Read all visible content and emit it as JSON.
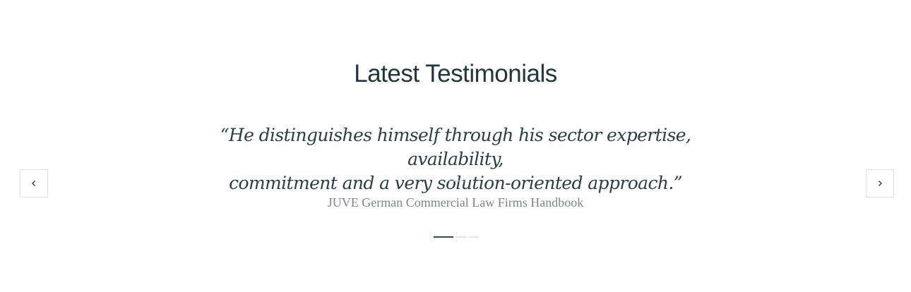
{
  "section": {
    "title": "Latest Testimonials"
  },
  "testimonial": {
    "quote_line1": "“He distinguishes himself through his sector expertise, availability,",
    "quote_line2": "commitment and a very solution-oriented approach.”",
    "source": "JUVE German Commercial Law Firms Handbook"
  },
  "carousel": {
    "prev_icon": "chevron-left-icon",
    "next_icon": "chevron-right-icon",
    "slide_count": 3,
    "active_index": 0
  },
  "colors": {
    "title": "#22363d",
    "quote": "#2b3e44",
    "source": "#7e8587",
    "active_dot": "#3a4a4f",
    "inactive_dot": "#e3e6e7",
    "border": "#dcdfe0"
  }
}
